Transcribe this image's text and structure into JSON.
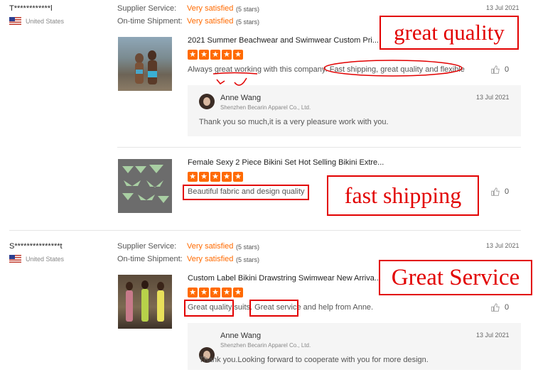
{
  "reviews": [
    {
      "user": "T************l",
      "country": "United States",
      "supplier_service_label": "Supplier Service:",
      "supplier_service_value": "Very satisfied",
      "supplier_service_stars": "(5 stars)",
      "ontime_label": "On-time Shipment:",
      "ontime_value": "Very satisfied",
      "ontime_stars": "(5 stars)",
      "date": "13 Jul 2021",
      "products": [
        {
          "title": "2021 Summer Beachwear and Swimwear Custom Pri...",
          "comment_a": "Always great working with this company. ",
          "comment_b": "Fast shipping, great quality and flexible",
          "likes": "0",
          "reply": {
            "name": "Anne Wang",
            "company": "Shenzhen Becarin Apparel Co., Ltd.",
            "date": "13 Jul 2021",
            "text": "Thank you so much,it is a very pleasure work with you."
          }
        },
        {
          "title": "Female Sexy 2 Piece Bikini Set Hot Selling Bikini Extre...",
          "comment": "Beautiful fabric and design quality",
          "likes": "0"
        }
      ]
    },
    {
      "user": "S***************t",
      "country": "United States",
      "supplier_service_label": "Supplier Service:",
      "supplier_service_value": "Very satisfied",
      "supplier_service_stars": "(5 stars)",
      "ontime_label": "On-time Shipment:",
      "ontime_value": "Very satisfied",
      "ontime_stars": "(5 stars)",
      "date": "13 Jul 2021",
      "products": [
        {
          "title": "Custom Label Bikini Drawstring Swimwear New Arriva...",
          "comment_a": "Great quality",
          "comment_b": " suits. ",
          "comment_c": "Great service",
          "comment_d": " and help from Anne.",
          "likes": "0",
          "reply": {
            "name": "Anne Wang",
            "company": "Shenzhen Becarin Apparel Co., Ltd.",
            "date": "13 Jul 2021",
            "text": "Thank you.Looking forward to cooperate with you for more design."
          }
        }
      ]
    }
  ],
  "annotations": {
    "label1": "great quality",
    "label2": "fast shipping",
    "label3": "Great Service"
  },
  "colors": {
    "accent": "#ff6a00",
    "annotation": "#e20000"
  },
  "icons": {
    "star": "star-icon",
    "like": "thumbs-up-icon",
    "flag": "us-flag-icon"
  }
}
